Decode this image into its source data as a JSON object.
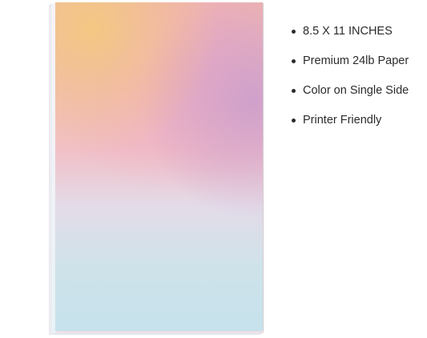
{
  "features": [
    {
      "text": "8.5 X 11 INCHES"
    },
    {
      "text": "Premium 24lb Paper"
    },
    {
      "text": "Color on Single Side"
    },
    {
      "text": "Printer Friendly"
    }
  ],
  "colors": {
    "text": "#2b2b2b",
    "gradient_top_left": "#f4c980",
    "gradient_pink": "#eea8c4",
    "gradient_purple": "#cc9ecd",
    "gradient_bottom": "#c6e2ec"
  }
}
